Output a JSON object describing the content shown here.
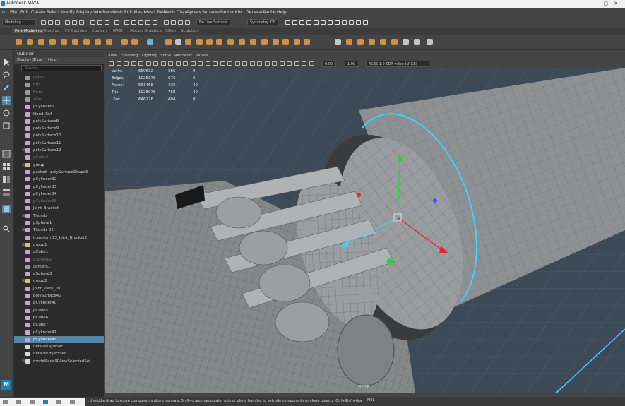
{
  "window": {
    "title": "Autodesk MAYA"
  },
  "menubar": {
    "items": [
      "File",
      "Edit",
      "Create",
      "Select",
      "Modify",
      "Display",
      "Windows",
      "Mesh",
      "Edit Mesh",
      "Mesh Tools",
      "Mesh Display",
      "Curves",
      "Surfaces",
      "Deform",
      "UV",
      "Generate",
      "Cache",
      "Help"
    ]
  },
  "statusline": {
    "mode": "Modeling",
    "live_surface": "No Live Surface",
    "symmetry": "Symmetry: Off"
  },
  "shelf": {
    "tabs": [
      "Poly Modeling",
      "Rigging",
      "FX Caching",
      "Custom",
      "MASH",
      "Motion Graphics",
      "XGen",
      "Sculpting"
    ],
    "active_tab": "Poly Modeling"
  },
  "outliner": {
    "title": "Outliner",
    "menu": [
      "Display",
      "Show",
      "Help"
    ],
    "search_placeholder": "Search...",
    "items": [
      {
        "label": "persp",
        "type": "camera",
        "dim": true,
        "expand": ""
      },
      {
        "label": "top",
        "type": "camera",
        "dim": true,
        "expand": ""
      },
      {
        "label": "front",
        "type": "camera",
        "dim": true,
        "expand": ""
      },
      {
        "label": "side",
        "type": "camera",
        "dim": true,
        "expand": ""
      },
      {
        "label": "pCylinder1",
        "type": "mesh",
        "dim": false,
        "expand": ""
      },
      {
        "label": "Hand_Ref",
        "type": "mesh",
        "dim": false,
        "expand": ""
      },
      {
        "label": "polySurface8",
        "type": "mesh",
        "dim": false,
        "expand": ""
      },
      {
        "label": "polySurface9",
        "type": "mesh",
        "dim": false,
        "expand": ""
      },
      {
        "label": "polySurface10",
        "type": "mesh",
        "dim": false,
        "expand": ""
      },
      {
        "label": "polySurface11",
        "type": "mesh",
        "dim": false,
        "expand": ""
      },
      {
        "label": "polySurface12",
        "type": "mesh",
        "dim": false,
        "expand": "⊞"
      },
      {
        "label": "pCube2",
        "type": "mesh",
        "dim": true,
        "expand": ""
      },
      {
        "label": "group",
        "type": "group",
        "dim": false,
        "expand": "⊞"
      },
      {
        "label": "pasted__polySurfaceShape5",
        "type": "mesh",
        "dim": false,
        "expand": ""
      },
      {
        "label": "pCylinder32",
        "type": "mesh",
        "dim": false,
        "expand": ""
      },
      {
        "label": "pCylinder33",
        "type": "mesh",
        "dim": false,
        "expand": ""
      },
      {
        "label": "pCylinder34",
        "type": "mesh",
        "dim": false,
        "expand": ""
      },
      {
        "label": "pCylinder35",
        "type": "mesh",
        "dim": true,
        "expand": ""
      },
      {
        "label": "Joint_Bracket",
        "type": "mesh",
        "dim": false,
        "expand": ""
      },
      {
        "label": "Thumb",
        "type": "mesh",
        "dim": false,
        "expand": "⊞"
      },
      {
        "label": "pSphere1",
        "type": "mesh",
        "dim": false,
        "expand": ""
      },
      {
        "label": "Thumb_02",
        "type": "mesh",
        "dim": false,
        "expand": "⊞"
      },
      {
        "label": "transform13_Joint_Bracket2",
        "type": "mesh",
        "dim": false,
        "expand": ""
      },
      {
        "label": "group1",
        "type": "group",
        "dim": false,
        "expand": "⊞"
      },
      {
        "label": "pCube1",
        "type": "mesh",
        "dim": false,
        "expand": ""
      },
      {
        "label": "pSphere2",
        "type": "mesh",
        "dim": true,
        "expand": ""
      },
      {
        "label": "camera1",
        "type": "camera",
        "dim": false,
        "expand": ""
      },
      {
        "label": "pSphere3",
        "type": "mesh",
        "dim": false,
        "expand": ""
      },
      {
        "label": "group2",
        "type": "group",
        "dim": false,
        "expand": "⊞"
      },
      {
        "label": "Joint_Plate_28",
        "type": "mesh",
        "dim": false,
        "expand": ""
      },
      {
        "label": "polySurface40",
        "type": "mesh",
        "dim": false,
        "expand": ""
      },
      {
        "label": "pCylinder40",
        "type": "mesh",
        "dim": false,
        "expand": ""
      },
      {
        "label": "pCube5",
        "type": "mesh",
        "dim": false,
        "expand": ""
      },
      {
        "label": "pCube6",
        "type": "mesh",
        "dim": false,
        "expand": ""
      },
      {
        "label": "pCube7",
        "type": "mesh",
        "dim": false,
        "expand": ""
      },
      {
        "label": "pCylinder41",
        "type": "mesh",
        "dim": false,
        "expand": ""
      },
      {
        "label": "pCylinder45",
        "type": "mesh",
        "dim": false,
        "expand": "",
        "selected": true
      },
      {
        "label": "defaultLightSet",
        "type": "set",
        "dim": false,
        "expand": ""
      },
      {
        "label": "defaultObjectSet",
        "type": "set",
        "dim": false,
        "expand": ""
      },
      {
        "label": "modelPanel4ViewSelectedSet",
        "type": "set",
        "dim": false,
        "expand": "⊞"
      }
    ]
  },
  "viewport": {
    "menu": [
      "View",
      "Shading",
      "Lighting",
      "Show",
      "Renderer",
      "Panels"
    ],
    "field1": "0.00",
    "field2": "1.00",
    "colorspace": "ACES 1.0 SDR-video (sRGB)",
    "camera_label": "persp",
    "hud": [
      {
        "label": "Verts:",
        "a": "559632",
        "b": "386",
        "c": "0"
      },
      {
        "label": "Edges:",
        "a": "1028176",
        "b": "676",
        "c": "0"
      },
      {
        "label": "Faces:",
        "a": "531468",
        "b": "432",
        "c": "40"
      },
      {
        "label": "Tris:",
        "a": "1028976",
        "b": "768",
        "c": "40"
      },
      {
        "label": "UVs:",
        "a": "646278",
        "b": "484",
        "c": "0"
      }
    ]
  },
  "helpline": {
    "text": "...d middle drag to move components along normals. Shift+drag manipulator axis or plane handles to extrude components or clone objects. Ctrl+Shift+drag to constrain movement to ...",
    "mel": "MEL"
  },
  "colors": {
    "selection": "#5285a6",
    "accent_blue": "#3fd3ff",
    "mesh": "#8c8f92",
    "bg_viewport": "#3c4a57"
  }
}
